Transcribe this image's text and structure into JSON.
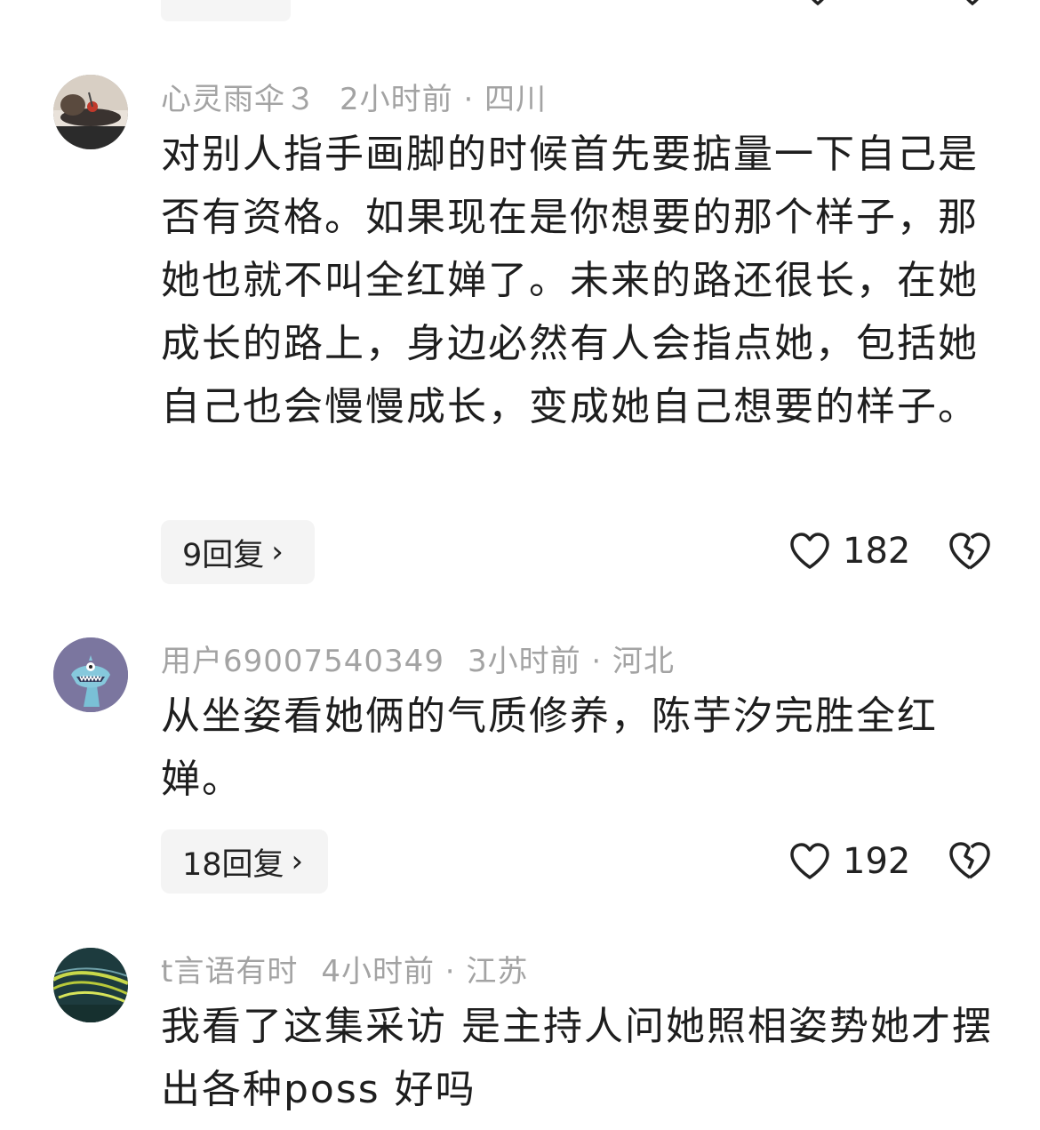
{
  "comments": [
    {
      "user": "心灵雨伞３",
      "time_location": "2小时前 · 四川",
      "text": "对别人指手画脚的时候首先要掂量一下自己是否有资格。如果现在是你想要的那个样子，那她也就不叫全红婵了。未来的路还很长，在她成长的路上，身边必然有人会指点她，包括她自己也会慢慢成长，变成她自己想要的样子。",
      "reply_label": "9回复",
      "likes": "182"
    },
    {
      "user": "用户69007540349",
      "time_location": "3小时前 · 河北",
      "text": "从坐姿看她俩的气质修养，陈芋汐完胜全红婵。",
      "reply_label": "18回复",
      "likes": "192"
    },
    {
      "user": "t言语有时",
      "time_location": "4小时前 · 江苏",
      "text": "我看了这集采访 是主持人问她照相姿势她才摆出各种poss 好吗"
    }
  ],
  "icons": {
    "like": "heart-outline-icon",
    "dislike": "broken-heart-icon",
    "chevron": "chevron-right-icon"
  }
}
